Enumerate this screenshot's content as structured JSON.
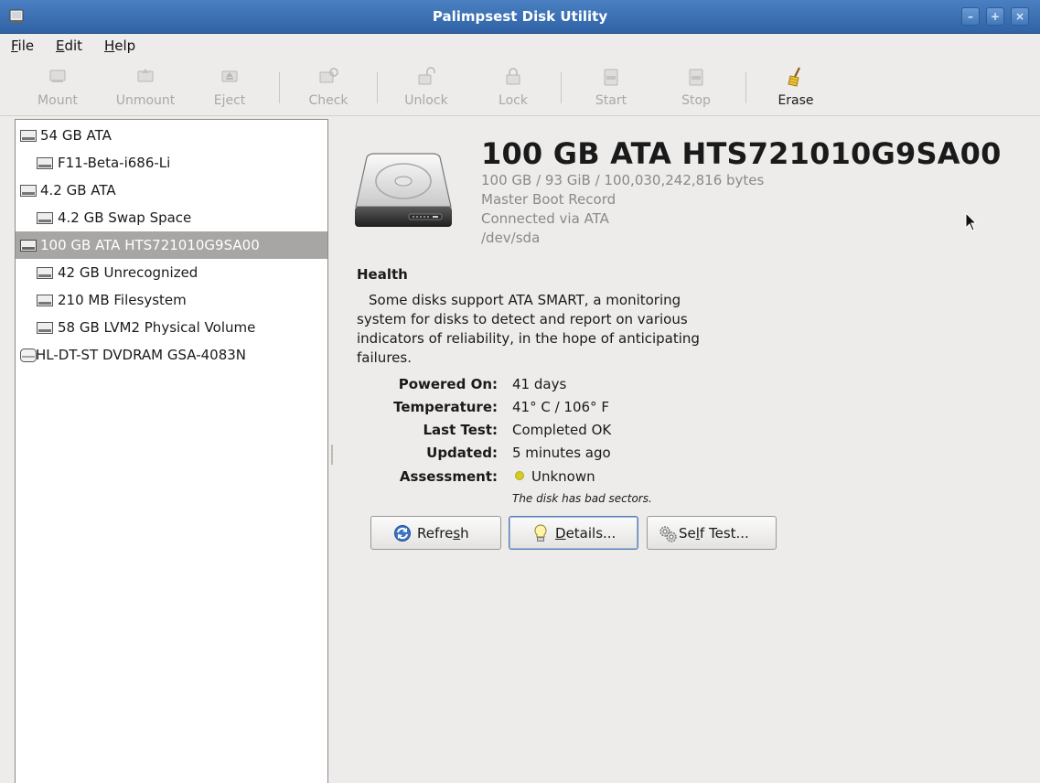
{
  "window": {
    "title": "Palimpsest Disk Utility"
  },
  "menubar": {
    "items": [
      {
        "key": "F",
        "rest": "ile"
      },
      {
        "key": "E",
        "rest": "dit"
      },
      {
        "key": "H",
        "rest": "elp"
      }
    ]
  },
  "toolbar": {
    "mount": "Mount",
    "unmount": "Unmount",
    "eject": "Eject",
    "check": "Check",
    "unlock": "Unlock",
    "lock": "Lock",
    "start": "Start",
    "stop": "Stop",
    "erase": "Erase"
  },
  "sidebar": {
    "items": [
      {
        "label": "54 GB ATA",
        "icon": "hard-disk-icon"
      },
      {
        "label": "F11-Beta-i686-Li",
        "icon": "partition-icon"
      },
      {
        "label": "4.2 GB ATA",
        "icon": "hard-disk-icon"
      },
      {
        "label": "4.2 GB Swap Space",
        "icon": "partition-icon"
      },
      {
        "label": "100 GB ATA HTS721010G9SA00",
        "icon": "hard-disk-icon",
        "selected": true
      },
      {
        "label": "42 GB Unrecognized",
        "icon": "partition-icon"
      },
      {
        "label": "210 MB Filesystem",
        "icon": "partition-icon"
      },
      {
        "label": "58 GB LVM2 Physical Volume",
        "icon": "partition-icon"
      },
      {
        "label": "HL-DT-ST DVDRAM GSA-4083N",
        "icon": "optical-drive-icon"
      }
    ]
  },
  "disk": {
    "title": "100 GB ATA HTS721010G9SA00",
    "size": "100 GB / 93 GiB / 100,030,242,816 bytes",
    "partitioning": "Master Boot Record",
    "connection": "Connected via ATA",
    "device": "/dev/sda"
  },
  "health": {
    "heading": "Health",
    "description": "Some disks support ATA SMART, a monitoring system for disks to detect and report on various indicators of reliability, in the hope of anticipating failures.",
    "description_lines": [
      "Some disks support ATA SMART, a monitoring",
      "system for disks to detect and report on various",
      "indicators of reliability, in the hope of anticipating",
      "failures."
    ],
    "fields": {
      "powered_on": {
        "label": "Powered On:",
        "value": "41 days"
      },
      "temperature": {
        "label": "Temperature:",
        "value": "41° C / 106° F"
      },
      "last_test": {
        "label": "Last Test:",
        "value": "Completed OK"
      },
      "updated": {
        "label": "Updated:",
        "value": "5 minutes ago"
      },
      "assessment": {
        "label": "Assessment:",
        "value": "Unknown"
      }
    },
    "note": "The disk has bad sectors.",
    "status_color": "#d6cc21"
  },
  "buttons": {
    "refresh": {
      "pre": "Refre",
      "key": "s",
      "post": "h"
    },
    "details": {
      "pre": "",
      "key": "D",
      "post": "etails..."
    },
    "self_test": {
      "pre": "Se",
      "key": "l",
      "post": "f Test..."
    }
  },
  "colors": {
    "titlebar": "#3a6fb3",
    "selection": "#a7a6a4",
    "window_bg": "#edeceb"
  }
}
